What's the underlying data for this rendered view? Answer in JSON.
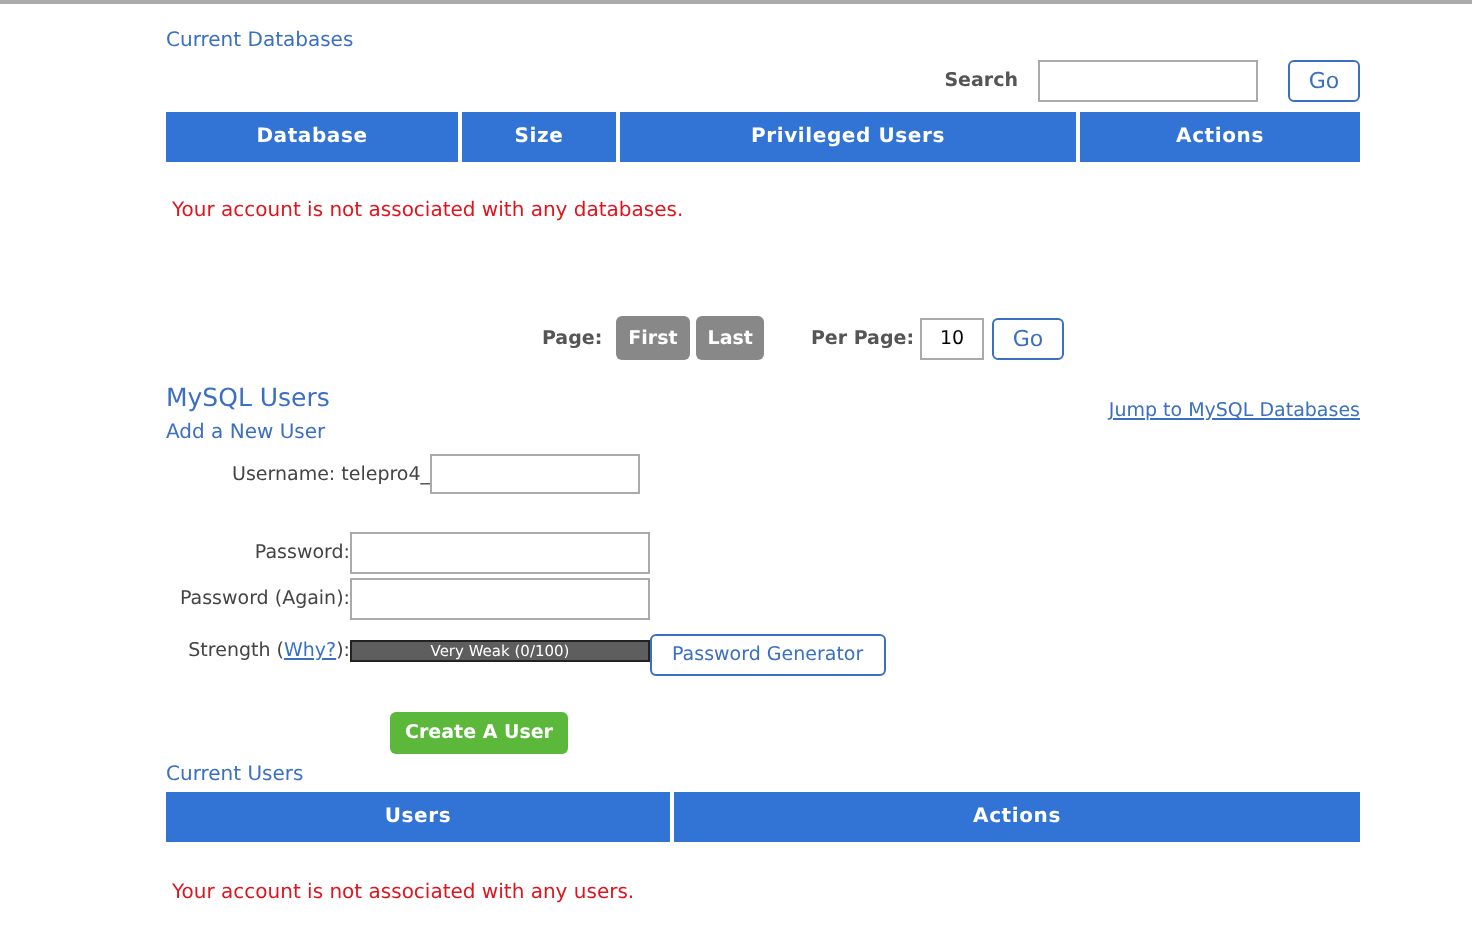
{
  "databases": {
    "heading": "Current Databases",
    "search": {
      "label": "Search",
      "button": "Go"
    },
    "columns": [
      "Database",
      "Size",
      "Privileged Users",
      "Actions"
    ],
    "empty_message": "Your account is not associated with any databases.",
    "pagination": {
      "page_label": "Page:",
      "first": "First",
      "last": "Last",
      "per_page_label": "Per Page:",
      "per_page": "10",
      "button": "Go"
    }
  },
  "users": {
    "heading": "MySQL Users",
    "jump_link": "Jump to MySQL Databases",
    "form_title": "Add a New User",
    "username_label": "Username:",
    "username_prefix": "telepro4_",
    "password_label": "Password:",
    "password_again_label": "Password (Again):",
    "strength_label": "Strength (",
    "strength_link": "Why?",
    "strength_label_end": "):",
    "strength": {
      "level": 0,
      "reading": "Very Weak (0/100)"
    },
    "generator_button": "Password Generator",
    "create_button": "Create A User"
  },
  "current_users": {
    "heading": "Current Users",
    "columns": [
      "Users",
      "Actions"
    ],
    "empty_message": "Your account is not associated with any users."
  }
}
